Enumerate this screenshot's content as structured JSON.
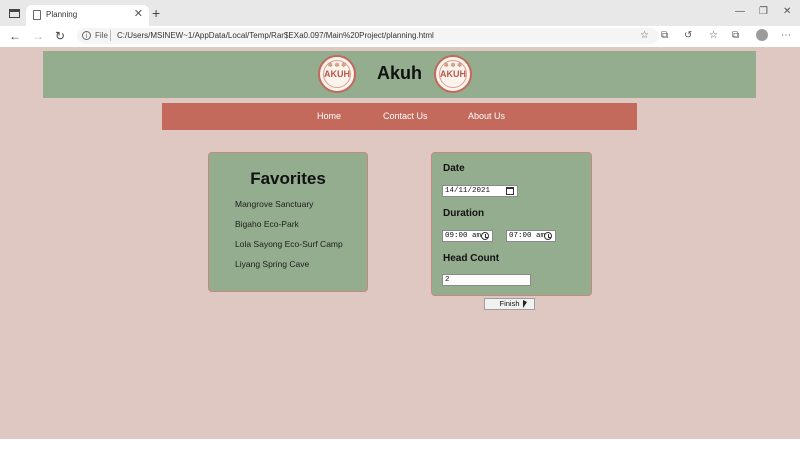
{
  "browser": {
    "tab_title": "Planning",
    "tab_close": "✕",
    "new_tab": "+",
    "minimize": "—",
    "restore": "❐",
    "close": "✕",
    "back": "←",
    "forward": "→",
    "refresh": "↻",
    "info_glyph": "i",
    "file_label": "File",
    "url": "C:/Users/MSINEW~1/AppData/Local/Temp/Rar$EXa0.097/Main%20Project/planning.html",
    "favorite_glyph": "☆",
    "toolbar_glyphs": [
      "⧉",
      "↺",
      "☆",
      "⧉",
      "⋯"
    ]
  },
  "header": {
    "title": "Akuh",
    "logo_text": "AKUH",
    "logo_sprig": "✽ ✽ ✽"
  },
  "nav": {
    "items": [
      {
        "label": "Home"
      },
      {
        "label": "Contact Us"
      },
      {
        "label": "About Us"
      }
    ]
  },
  "favorites": {
    "title": "Favorites",
    "items": [
      "Mangrove Sanctuary",
      "Bigaho Eco-Park",
      "Lola Sayong Eco-Surf Camp",
      "Liyang Spring Cave"
    ]
  },
  "planning": {
    "date_label": "Date",
    "date_value": "14/11/2021",
    "duration_label": "Duration",
    "start_time": "09:00 am",
    "end_time": "07:00 am",
    "headcount_label": "Head Count",
    "headcount_value": "2",
    "finish_label": "Finish"
  },
  "colors": {
    "page_bg": "#dfc8c1",
    "header_bg": "#94ad8e",
    "nav_bg": "#c46a5c",
    "logo_red": "#c1695b"
  }
}
